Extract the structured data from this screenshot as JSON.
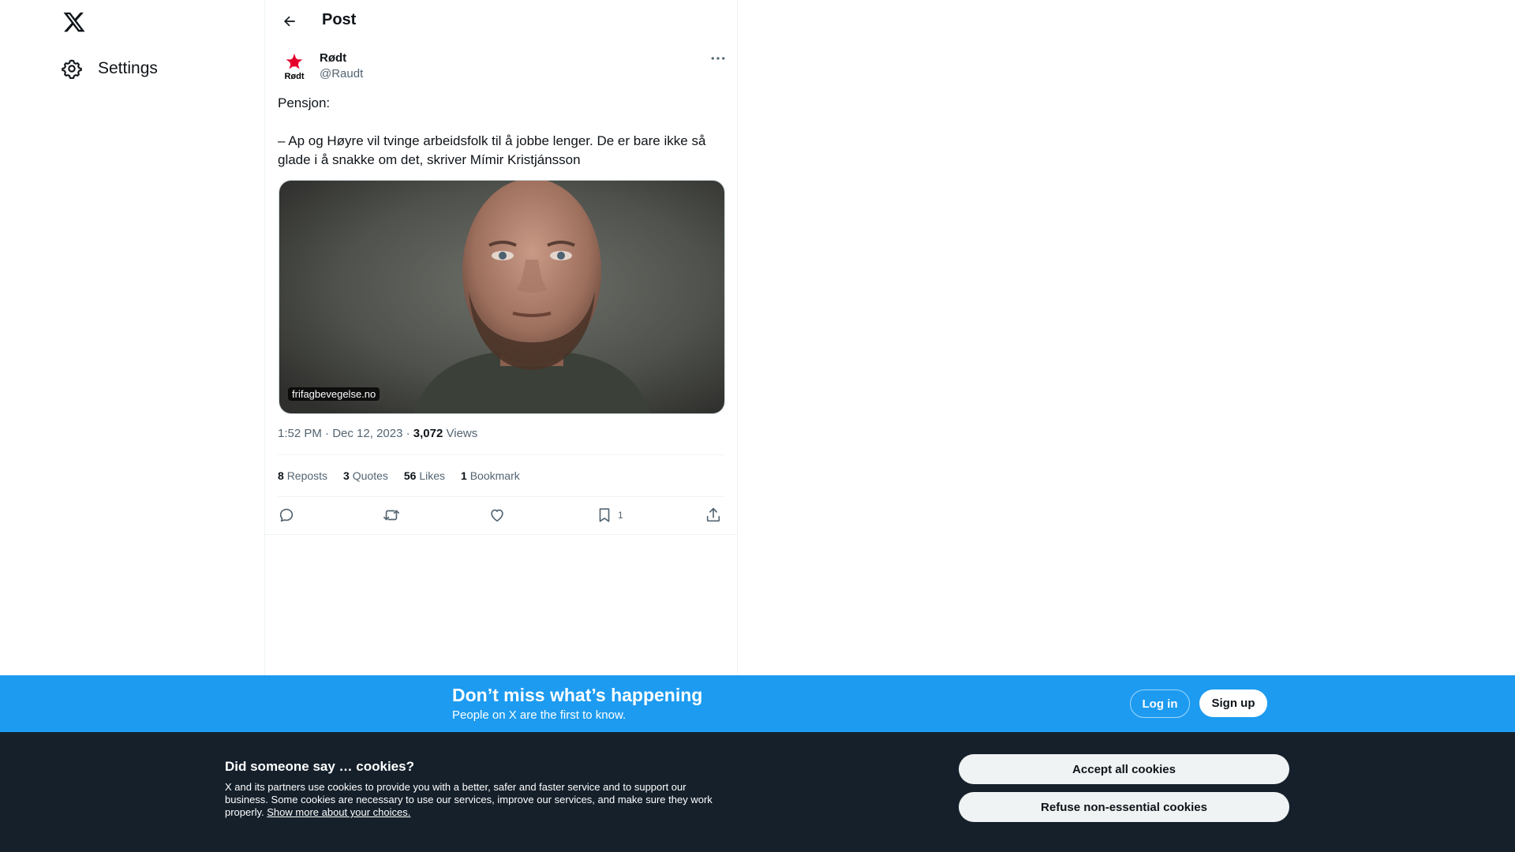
{
  "nav": {
    "settings_label": "Settings"
  },
  "header": {
    "title": "Post"
  },
  "post": {
    "author_name": "Rødt",
    "author_handle": "@Raudt",
    "avatar_text": "Rødt",
    "text_line1": "Pensjon:",
    "text_line2": "– Ap og Høyre vil tvinge arbeidsfolk til å jobbe lenger. De er bare ikke så glade i å snakke om det, skriver Mímir Kristjánsson",
    "card_domain": "frifagbevegelse.no",
    "time": "1:52 PM",
    "date": "Dec 12, 2023",
    "separator": "·",
    "views_count": "3,072",
    "views_label": "Views",
    "stats": {
      "reposts_count": "8",
      "reposts_label": "Reposts",
      "quotes_count": "3",
      "quotes_label": "Quotes",
      "likes_count": "56",
      "likes_label": "Likes",
      "bookmarks_count": "1",
      "bookmarks_label": "Bookmark"
    },
    "bookmark_action_count": "1"
  },
  "signup_bar": {
    "title": "Don’t miss what’s happening",
    "subtitle": "People on X are the first to know.",
    "login_label": "Log in",
    "signup_label": "Sign up"
  },
  "cookies": {
    "title": "Did someone say … cookies?",
    "body": "X and its partners use cookies to provide you with a better, safer and faster service and to support our business. Some cookies are necessary to use our services, improve our services, and make sure they work properly.",
    "link": "Show more about your choices.",
    "accept_label": "Accept all cookies",
    "refuse_label": "Refuse non-essential cookies"
  },
  "colors": {
    "accent_blue": "#1d9bf0",
    "cookie_bg": "#15202b",
    "text_primary": "#0f1419",
    "text_secondary": "#536471",
    "brand_red": "#e4002b"
  },
  "icons": [
    "x-logo-icon",
    "gear-icon",
    "back-arrow-icon",
    "more-icon",
    "reply-icon",
    "repost-icon",
    "like-icon",
    "bookmark-icon",
    "share-icon"
  ]
}
